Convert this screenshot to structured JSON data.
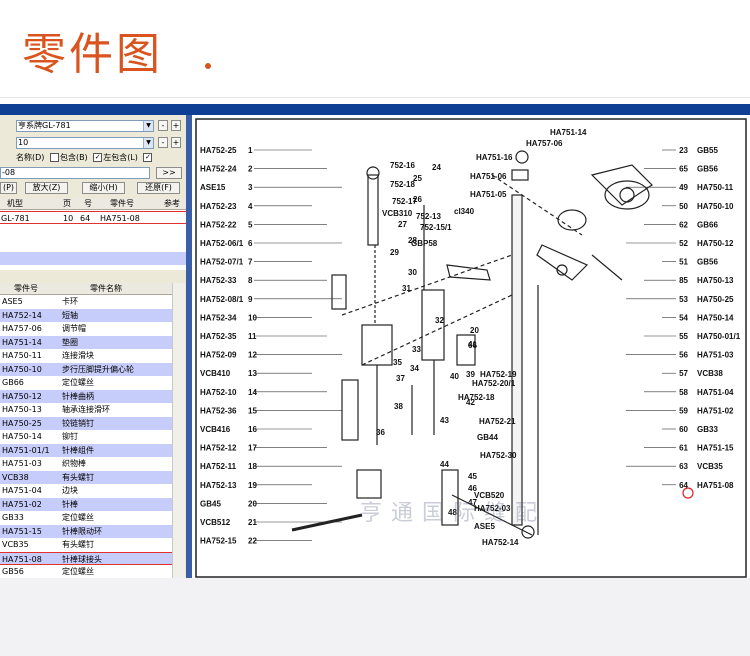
{
  "header": {
    "title": "零件图"
  },
  "selector": {
    "model_value": "亨系牌GL-781",
    "page_value": "10",
    "search_value": "-08",
    "arrow_label": ">>",
    "name_label": "名称(D)",
    "include_label1": "包含(B)",
    "include_label2": "左包含(L)"
  },
  "toolbar": {
    "print_label": "(P)",
    "zoom_in_label": "放大(Z)",
    "zoom_out_label": "缩小(H)",
    "restore_label": "还原(F)"
  },
  "results": {
    "headers": [
      "机型",
      "页",
      "号",
      "零件号",
      "参考"
    ],
    "row": [
      "GL-781",
      "10",
      "64",
      "HA751-08"
    ]
  },
  "parts": {
    "headers": [
      "零件号",
      "零件名称"
    ],
    "rows": [
      {
        "num": "ASE5",
        "name": "卡环"
      },
      {
        "num": "HA752-14",
        "name": "短轴"
      },
      {
        "num": "HA757-06",
        "name": "调节帽"
      },
      {
        "num": "HA751-14",
        "name": "垫圈"
      },
      {
        "num": "HA750-11",
        "name": "连接滑块"
      },
      {
        "num": "HA750-10",
        "name": "步行压脚提升偏心轮"
      },
      {
        "num": "GB66",
        "name": "定位螺丝"
      },
      {
        "num": "HA750-12",
        "name": "针棒曲柄"
      },
      {
        "num": "HA750-13",
        "name": "轴承连接滑环"
      },
      {
        "num": "HA750-25",
        "name": "铰链销钉"
      },
      {
        "num": "HA750-14",
        "name": "铆钉"
      },
      {
        "num": "HA751-01/1",
        "name": "针棒组件"
      },
      {
        "num": "HA751-03",
        "name": "织物棒"
      },
      {
        "num": "VCB38",
        "name": "有头螺钉"
      },
      {
        "num": "HA751-04",
        "name": "边块"
      },
      {
        "num": "HA751-02",
        "name": "针棒"
      },
      {
        "num": "GB33",
        "name": "定位螺丝"
      },
      {
        "num": "HA751-15",
        "name": "针棒限动环"
      },
      {
        "num": "VCB35",
        "name": "有头螺钉"
      },
      {
        "num": "HA751-08",
        "name": "针棒球接头"
      },
      {
        "num": "GB56",
        "name": "定位螺丝"
      }
    ]
  },
  "diagram": {
    "left_labels": [
      "HA752-25",
      "HA752-24",
      "ASE15",
      "HA752-23",
      "HA752-22",
      "HA752-06/1",
      "HA752-07/1",
      "HA752-33",
      "HA752-08/1",
      "HA752-34",
      "HA752-35",
      "HA752-09",
      "VCB410",
      "HA752-10",
      "HA752-36",
      "VCB416",
      "HA752-12",
      "HA752-11",
      "HA752-13",
      "GB45",
      "VCB512",
      "HA752-15"
    ],
    "left_numbers": [
      "1",
      "2",
      "3",
      "4",
      "5",
      "6",
      "7",
      "8",
      "9",
      "10",
      "11",
      "12",
      "13",
      "14",
      "15",
      "16",
      "17",
      "18",
      "19",
      "20",
      "21",
      "22"
    ],
    "top_labels": [
      "752-16",
      "752-18",
      "752-17",
      "VCB310",
      "752-13",
      "752-15/1",
      "GBP58",
      "cl340",
      "HA751-16",
      "HA751-06",
      "HA751-05",
      "HA751-14",
      "HA757-06"
    ],
    "right_labels": [
      "GB55",
      "GB56",
      "HA750-11",
      "HA750-10",
      "GB66",
      "HA750-12",
      "GB56",
      "HA750-13",
      "HA750-25",
      "HA750-14",
      "HA750-01/1",
      "HA751-03",
      "VCB38",
      "HA751-04",
      "HA751-02",
      "GB33",
      "HA751-15",
      "VCB35",
      "HA751-08"
    ],
    "right_numbers": [
      "23",
      "65",
      "49",
      "50",
      "62",
      "52",
      "51",
      "85",
      "53",
      "54",
      "55",
      "56",
      "57",
      "58",
      "59",
      "60",
      "61",
      "63",
      "64"
    ],
    "mid_labels": [
      "HA752-19",
      "HA752-20/1",
      "HA752-18",
      "HA752-21",
      "GB44",
      "HA752-30",
      "VCB520",
      "HA752-03",
      "ASE5",
      "HA752-14"
    ],
    "mid_numbers": [
      "24",
      "25",
      "26",
      "27",
      "28",
      "29",
      "30",
      "31",
      "32",
      "33",
      "34",
      "35",
      "36",
      "37",
      "38",
      "39",
      "40",
      "41",
      "42",
      "43",
      "44",
      "45",
      "46",
      "47",
      "48",
      "66",
      "20"
    ],
    "watermark": "亨通国际缝配"
  },
  "colors": {
    "accent": "#d9541e",
    "navy": "#0f3f94",
    "row_highlight": "#c7cdfa"
  }
}
